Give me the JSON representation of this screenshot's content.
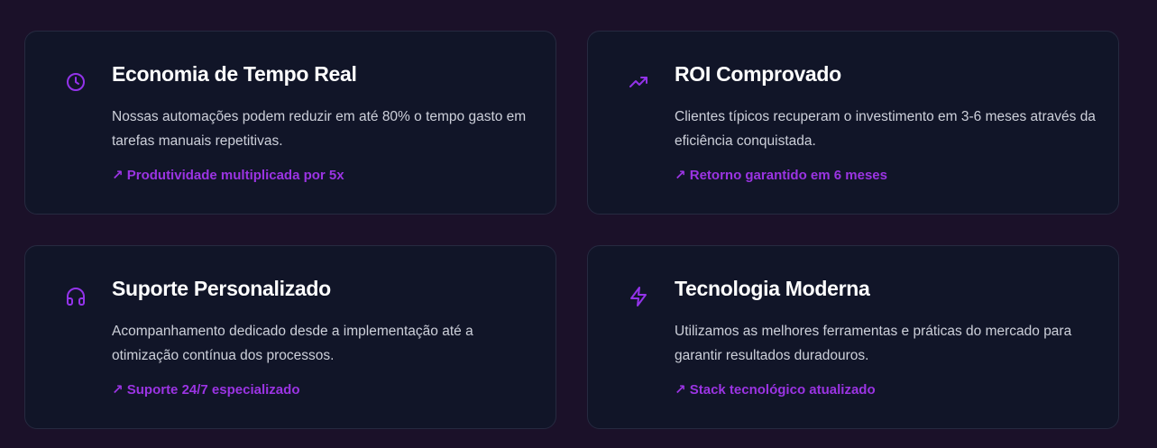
{
  "colors": {
    "background": "#1b1129",
    "card": "#111528",
    "accent": "#9333ea",
    "title": "#ffffff",
    "text": "#cdd0da"
  },
  "cards": [
    {
      "icon": "clock-icon",
      "title": "Economia de Tempo Real",
      "description": "Nossas automações podem reduzir em até 80% o tempo gasto em tarefas manuais repetitivas.",
      "highlight": "↗ Produtividade multiplicada por 5x"
    },
    {
      "icon": "trending-up-icon",
      "title": "ROI Comprovado",
      "description": "Clientes típicos recuperam o investimento em 3-6 meses através da eficiência conquistada.",
      "highlight": "↗ Retorno garantido em 6 meses"
    },
    {
      "icon": "headphones-icon",
      "title": "Suporte Personalizado",
      "description": "Acompanhamento dedicado desde a implementação até a otimização contínua dos processos.",
      "highlight": "↗ Suporte 24/7 especializado"
    },
    {
      "icon": "lightning-icon",
      "title": "Tecnologia Moderna",
      "description": "Utilizamos as melhores ferramentas e práticas do mercado para garantir resultados duradouros.",
      "highlight": "↗ Stack tecnológico atualizado"
    }
  ]
}
